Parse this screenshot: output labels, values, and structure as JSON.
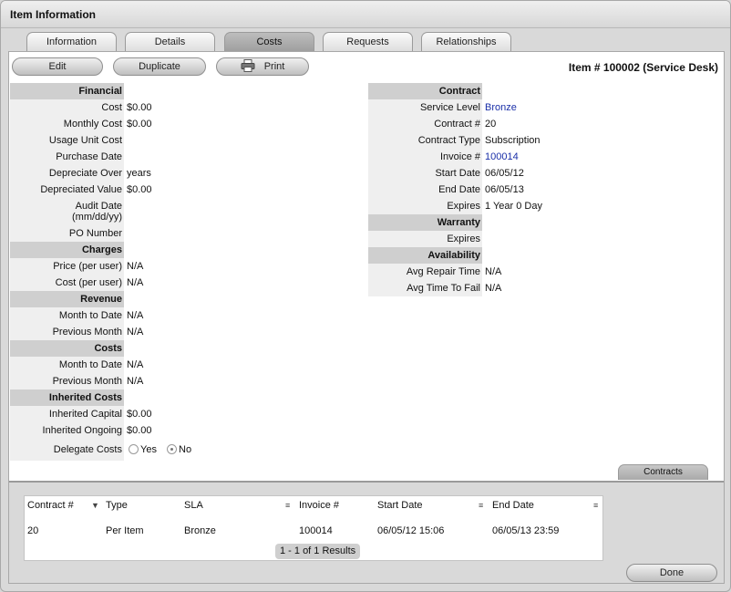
{
  "window": {
    "title": "Item Information"
  },
  "tabs": [
    {
      "label": "Information",
      "active": false
    },
    {
      "label": "Details",
      "active": false
    },
    {
      "label": "Costs",
      "active": true
    },
    {
      "label": "Requests",
      "active": false
    },
    {
      "label": "Relationships",
      "active": false
    }
  ],
  "toolbar": {
    "edit_label": "Edit",
    "duplicate_label": "Duplicate",
    "print_label": "Print"
  },
  "item_title": "Item # 100002 (Service Desk)",
  "left": {
    "financial": {
      "header": "Financial",
      "cost_label": "Cost",
      "cost": "$0.00",
      "monthly_cost_label": "Monthly Cost",
      "monthly_cost": "$0.00",
      "usage_unit_cost_label": "Usage Unit Cost",
      "purchase_date_label": "Purchase Date",
      "depreciate_over_label": "Depreciate Over",
      "depreciate_over": "years",
      "depreciated_value_label": "Depreciated Value",
      "depreciated_value": "$0.00",
      "audit_date_label": "Audit Date",
      "audit_date_format": "(mm/dd/yy)",
      "po_number_label": "PO Number"
    },
    "charges": {
      "header": "Charges",
      "price_label": "Price (per user)",
      "price": "N/A",
      "cost_label": "Cost (per user)",
      "cost": "N/A"
    },
    "revenue": {
      "header": "Revenue",
      "mtd_label": "Month to Date",
      "mtd": "N/A",
      "prev_label": "Previous Month",
      "prev": "N/A"
    },
    "costs": {
      "header": "Costs",
      "mtd_label": "Month to Date",
      "mtd": "N/A",
      "prev_label": "Previous Month",
      "prev": "N/A"
    },
    "inherited": {
      "header": "Inherited Costs",
      "capital_label": "Inherited Capital",
      "capital": "$0.00",
      "ongoing_label": "Inherited Ongoing",
      "ongoing": "$0.00",
      "delegate_label": "Delegate Costs",
      "yes_label": "Yes",
      "no_label": "No",
      "selected": "No"
    }
  },
  "right": {
    "contract": {
      "header": "Contract",
      "service_level_label": "Service Level",
      "service_level": "Bronze",
      "contract_no_label": "Contract #",
      "contract_no": "20",
      "contract_type_label": "Contract Type",
      "contract_type": "Subscription",
      "invoice_label": "Invoice #",
      "invoice": "100014",
      "start_date_label": "Start Date",
      "start_date": "06/05/12",
      "end_date_label": "End Date",
      "end_date": "06/05/13",
      "expires_label": "Expires",
      "expires": "1 Year 0 Day"
    },
    "warranty": {
      "header": "Warranty",
      "expires_label": "Expires"
    },
    "availability": {
      "header": "Availability",
      "repair_label": "Avg Repair Time",
      "repair": "N/A",
      "fail_label": "Avg Time To Fail",
      "fail": "N/A"
    }
  },
  "contracts_tab_label": "Contracts",
  "contracts_table": {
    "columns": [
      "Contract #",
      "Type",
      "SLA",
      "Invoice #",
      "Start Date",
      "End Date"
    ],
    "rows": [
      {
        "contract": "20",
        "type": "Per Item",
        "sla": "Bronze",
        "invoice": "100014",
        "start": "06/05/12 15:06",
        "end": "06/05/13 23:59"
      }
    ],
    "pager": "1 - 1 of 1 Results"
  },
  "done_label": "Done"
}
